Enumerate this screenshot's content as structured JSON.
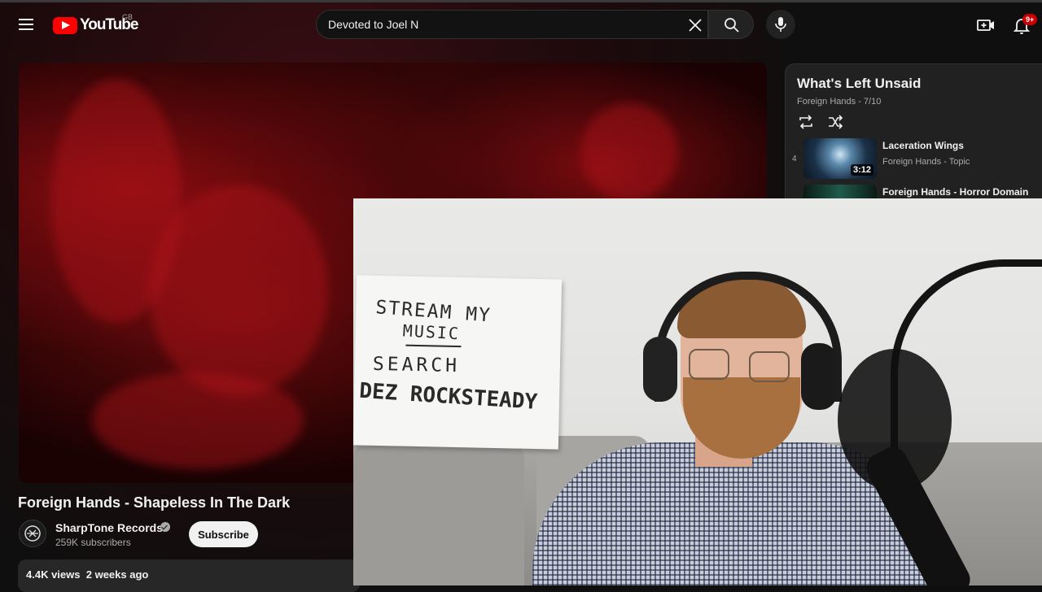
{
  "header": {
    "logo_text": "YouTube",
    "country_code": "GB",
    "search": {
      "value": "Devoted to Joel N"
    },
    "notifications_badge": "9+"
  },
  "video": {
    "title": "Foreign Hands - Shapeless In The Dark",
    "channel": {
      "name": "SharpTone Records",
      "subscribers": "259K subscribers",
      "subscribe_label": "Subscribe"
    },
    "views": "4.4K views",
    "age": "2 weeks ago"
  },
  "playlist": {
    "title": "What's Left Unsaid",
    "meta": "Foreign Hands - 7/10",
    "items": [
      {
        "index": "4",
        "title": "Laceration Wings",
        "channel": "Foreign Hands - Topic",
        "duration": "3:12"
      },
      {
        "index": "",
        "title": "Foreign Hands - Horror Domain",
        "channel": "",
        "duration": ""
      }
    ]
  },
  "webcam": {
    "sign": {
      "line1": "STREAM MY",
      "line2": "MUSIC",
      "line3": "SEARCH",
      "line4": "DEZ ROCKSTEADY"
    }
  },
  "colors": {
    "background": "#0f0f0f",
    "brand_red": "#ff0000",
    "badge_red": "#cc0000",
    "text_primary": "#f1f1f1",
    "text_secondary": "#aaaaaa"
  },
  "icons": {
    "menu": "hamburger-icon",
    "clear": "close-icon",
    "search": "search-icon",
    "mic": "microphone-icon",
    "create": "video-plus-icon",
    "notifications": "bell-icon",
    "loop": "loop-icon",
    "shuffle": "shuffle-icon",
    "verified": "checkmark-badge-icon"
  }
}
